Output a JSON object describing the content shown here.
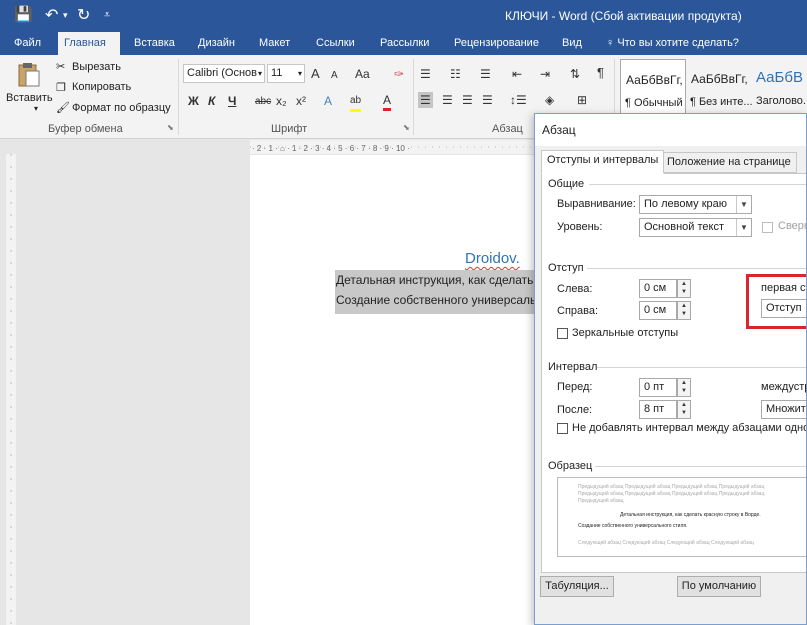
{
  "titlebar": {
    "title": "КЛЮЧИ - Word (Сбой активации продукта)",
    "qat": {
      "save_icon": "💾",
      "undo_icon": "↶",
      "redo_icon": "↻",
      "customize_icon": "⩡"
    }
  },
  "tabs": [
    {
      "label": "Файл"
    },
    {
      "label": "Главная"
    },
    {
      "label": "Вставка"
    },
    {
      "label": "Дизайн"
    },
    {
      "label": "Макет"
    },
    {
      "label": "Ссылки"
    },
    {
      "label": "Рассылки"
    },
    {
      "label": "Рецензирование"
    },
    {
      "label": "Вид"
    },
    {
      "label": "Что вы хотите сделать?"
    }
  ],
  "ribbon": {
    "clipboard": {
      "paste": "Вставить",
      "cut": "Вырезать",
      "copy": "Копировать",
      "format_painter": "Формат по образцу",
      "group": "Буфер обмена"
    },
    "font": {
      "font_name": "Calibri (Основ",
      "font_size": "11",
      "grow": "A",
      "shrink": "A",
      "case": "Aa",
      "clear": "✑",
      "bold": "Ж",
      "italic": "К",
      "underline": "Ч",
      "strike": "abc",
      "sub": "x₂",
      "sup": "x²",
      "effects": "A",
      "highlight": "ab",
      "color": "A",
      "group": "Шрифт"
    },
    "paragraph": {
      "group": "Абзац"
    },
    "styles": [
      {
        "preview": "АаБбВвГг,",
        "name": "¶ Обычный"
      },
      {
        "preview": "АаБбВвГг,",
        "name": "¶ Без инте..."
      },
      {
        "preview": "АаБбВ",
        "name": "Заголово..."
      }
    ]
  },
  "document": {
    "title": "Droidov.",
    "line1": "Детальная инструкция, как сделать",
    "line2": "Создание собственного универсаль"
  },
  "dialog": {
    "title": "Абзац",
    "tabs": [
      "Отступы и интервалы",
      "Положение на странице"
    ],
    "general": {
      "section": "Общие",
      "alignment_label": "Выравнивание:",
      "alignment_value": "По левому краю",
      "level_label": "Уровень:",
      "level_value": "Основной текст",
      "collapsed_label": "Сверну"
    },
    "indent": {
      "section": "Отступ",
      "left_label": "Слева:",
      "left_value": "0 см",
      "right_label": "Справа:",
      "right_value": "0 см",
      "first_line_label": "первая стр",
      "first_line_value": "Отступ",
      "mirror_label": "Зеркальные отступы"
    },
    "spacing": {
      "section": "Интервал",
      "before_label": "Перед:",
      "before_value": "0 пт",
      "after_label": "После:",
      "after_value": "8 пт",
      "line_label": "междустро",
      "line_value": "Множите",
      "no_space_label": "Не добавлять интервал между абзацами одного с"
    },
    "preview": {
      "section": "Образец",
      "prev1": "Предыдущий абзац Предыдущий абзац Предыдущий абзац Предыдущий абзац",
      "prev2": "Предыдущий абзац Предыдущий абзац Предыдущий абзац Предыдущий абзац",
      "prev3": "Предыдущий абзац",
      "sample1": "Детальная инструкция, как сделать красную строку в Ворде.",
      "sample2": "Создание собственного универсального стиля.",
      "next1": "Следующий абзац Следующий абзац Следующий абзац Следующий абзац"
    },
    "buttons": {
      "tabs": "Табуляция...",
      "default": "По умолчанию"
    }
  },
  "colors": {
    "accent": "#2b579a",
    "highlight_box": "#d9262c",
    "doc_title": "#2e74b5"
  }
}
